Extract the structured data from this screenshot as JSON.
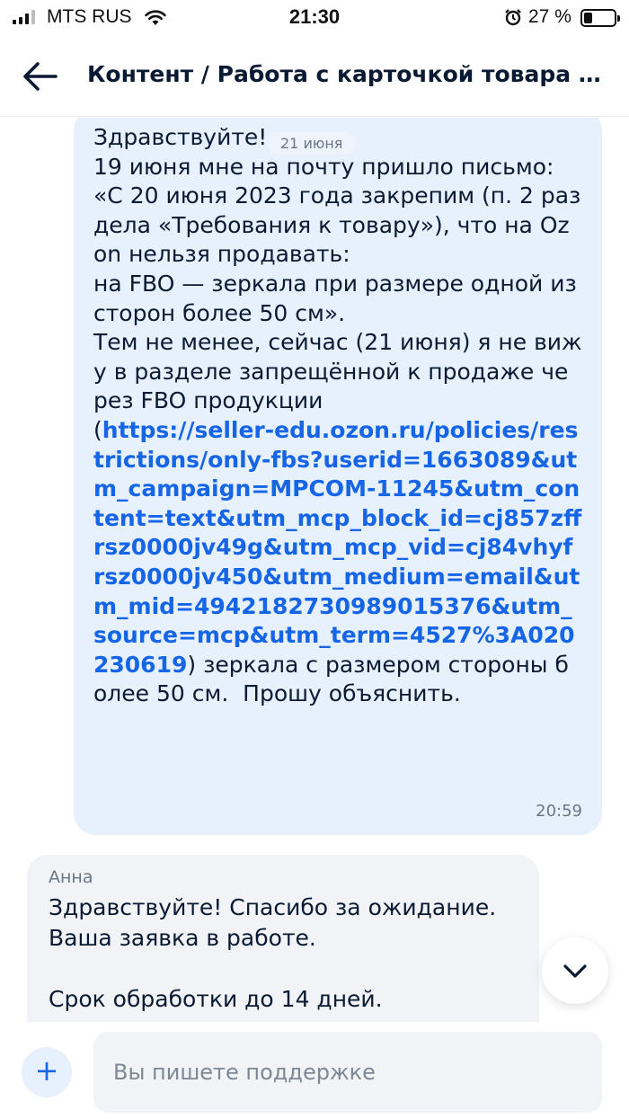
{
  "status_bar": {
    "carrier": "MTS RUS",
    "time": "21:30",
    "battery_text": "27 %",
    "battery_level": 0.27
  },
  "header": {
    "title": "Контент / Работа с карточкой товара / ..."
  },
  "chat": {
    "date_chip": "21 июня",
    "outgoing": {
      "text_before_link": "Здравствуйте!\n19 июня мне на почту пришло письмо:\n«С 20 июня 2023 года закрепим (п. 2 раздела «Требования к товару»), что на Ozon нельзя продавать:\nна FBO — зеркала при размере одной из сторон более 50 см».\nТем не менее, сейчас (21 июня) я не вижу в разделе запрещённой к продаже через FBO продукции\n(",
      "link": "https://seller-edu.ozon.ru/policies/restrictions/only-fbs?userid=1663089&utm_campaign=MPCOM-11245&utm_content=text&utm_mcp_block_id=cj857zffrsz0000jv49g&utm_mcp_vid=cj84vhyfrsz0000jv450&utm_medium=email&utm_mid=4942182730989015376&utm_source=mcp&utm_term=4527%3A020230619",
      "text_after_link": ") зеркала с размером стороны более 50 см.  Прошу объяснить.",
      "time": "20:59"
    },
    "incoming": {
      "sender": "Анна",
      "text": "Здравствуйте! Спасибо за ожидание.\nВаша заявка в работе.\n\nСрок обработки до 14 дней."
    }
  },
  "input": {
    "placeholder": "Вы пишете поддержке",
    "value": ""
  },
  "colors": {
    "accent": "#1565e6",
    "outgoing_bubble": "#e7f1fd",
    "incoming_bubble": "#f1f3f6"
  },
  "icons": [
    "signal-icon",
    "wifi-icon",
    "alarm-icon",
    "battery-icon",
    "back-arrow-icon",
    "chevron-down-icon",
    "plus-icon"
  ]
}
